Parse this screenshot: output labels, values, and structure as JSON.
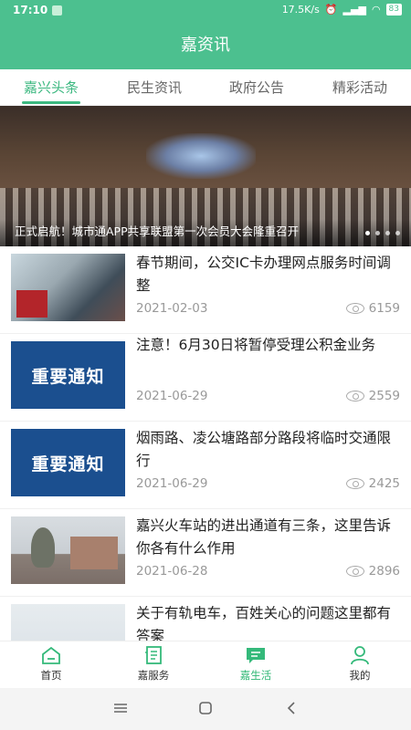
{
  "status_bar": {
    "time": "17:10",
    "network_speed": "17.5K/s",
    "signal_text": "..ıll ..ıll",
    "battery": "83"
  },
  "header": {
    "title": "嘉资讯"
  },
  "tabs": [
    {
      "label": "嘉兴头条",
      "active": true
    },
    {
      "label": "民生资讯",
      "active": false
    },
    {
      "label": "政府公告",
      "active": false
    },
    {
      "label": "精彩活动",
      "active": false
    }
  ],
  "banner": {
    "caption": "正式启航！城市通APP共享联盟第一次会员大会隆重召开",
    "dots": 4,
    "active_dot": 0
  },
  "news": [
    {
      "title": "春节期间，公交IC卡办理网点服务时间调整",
      "date": "2021-02-03",
      "views": "6159",
      "thumb": "photo"
    },
    {
      "title": "注意！6月30日将暂停受理公积金业务",
      "date": "2021-06-29",
      "views": "2559",
      "thumb": "notice",
      "thumb_text": "重要通知"
    },
    {
      "title": "烟雨路、凌公塘路部分路段将临时交通限行",
      "date": "2021-06-29",
      "views": "2425",
      "thumb": "notice",
      "thumb_text": "重要通知"
    },
    {
      "title": "嘉兴火车站的进出通道有三条，这里告诉你各有什么作用",
      "date": "2021-06-28",
      "views": "2896",
      "thumb": "photo"
    },
    {
      "title": "关于有轨电车，百姓关心的问题这里都有答案",
      "date": "",
      "views": "",
      "thumb": "photo"
    }
  ],
  "bottom_nav": [
    {
      "label": "首页",
      "icon": "home-icon",
      "active": false
    },
    {
      "label": "嘉服务",
      "icon": "service-icon",
      "active": false
    },
    {
      "label": "嘉生活",
      "icon": "chat-icon",
      "active": true
    },
    {
      "label": "我的",
      "icon": "user-icon",
      "active": false
    }
  ],
  "colors": {
    "brand": "#4cc08f",
    "active_tab": "#3cb880",
    "notice_blue": "#1b4f8f"
  }
}
